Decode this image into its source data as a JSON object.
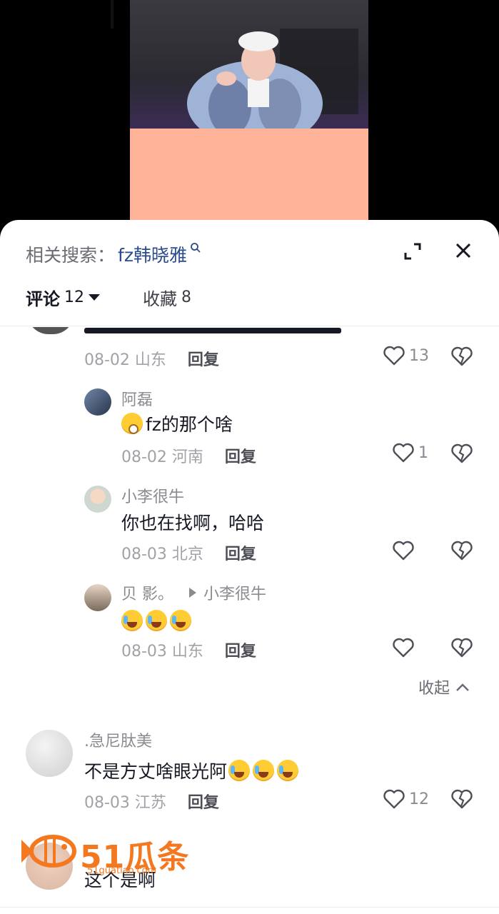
{
  "header": {
    "related_label": "相关搜索：",
    "related_keyword": "fz韩晓雅"
  },
  "tabs": [
    {
      "label": "评论",
      "count": "12"
    },
    {
      "label": "收藏",
      "count": "8"
    }
  ],
  "comments": {
    "top_partial": {
      "date_location": "08-02 山东",
      "reply": "回复",
      "likes": "13"
    },
    "replies": [
      {
        "user": "阿磊",
        "text": "fz的那个啥",
        "date_location": "08-02 河南",
        "reply": "回复",
        "likes": "1"
      },
      {
        "user": "小李很牛",
        "text": "你也在找啊，哈哈",
        "date_location": "08-03 北京",
        "reply": "回复",
        "likes": ""
      },
      {
        "user": "贝 影。",
        "reply_to": "小李很牛",
        "text": "",
        "date_location": "08-03 山东",
        "reply": "回复",
        "likes": ""
      }
    ],
    "collapse_label": "收起",
    "main": [
      {
        "user": ".急尼肽美",
        "text": "不是方丈啥眼光阿",
        "date_location": "08-03 江苏",
        "reply": "回复",
        "likes": "12"
      },
      {
        "user": "",
        "text": "这个是啊"
      }
    ]
  },
  "watermark": {
    "brand": "51瓜条",
    "site": "51guatiao.com"
  },
  "colors": {
    "link": "#2a4b8d",
    "brand": "#f4781f",
    "sheet_bg": "#ffffff",
    "video_bottom": "#ffb398"
  }
}
